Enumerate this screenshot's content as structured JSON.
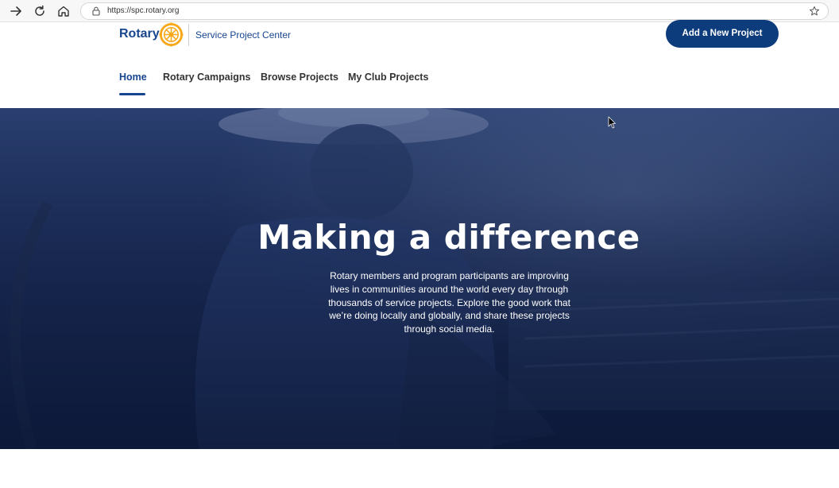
{
  "browser": {
    "url": "https://spc.rotary.org",
    "icons": [
      "back-arrow-icon",
      "reload-icon",
      "home-icon",
      "lock-icon",
      "star-icon"
    ]
  },
  "header": {
    "brand_word": "Rotary",
    "brand_sub": "Service Project Center",
    "cta_label": "Add a New Project",
    "nav": [
      {
        "label": "Home",
        "active": true
      },
      {
        "label": "Rotary Campaigns",
        "active": false
      },
      {
        "label": "Browse Projects",
        "active": false
      },
      {
        "label": "My Club Projects",
        "active": false
      }
    ]
  },
  "hero": {
    "title": "Making a difference",
    "body": "Rotary members and program participants are improving lives in communities around the world every day through thousands of service projects. Explore the good work that we’re doing locally and globally, and share these projects through social media."
  },
  "colors": {
    "brand_blue": "#17458f",
    "cta_blue": "#0c3c7c",
    "rotary_gold": "#f7a81b",
    "hero_overlay": "#1d2f5c"
  }
}
